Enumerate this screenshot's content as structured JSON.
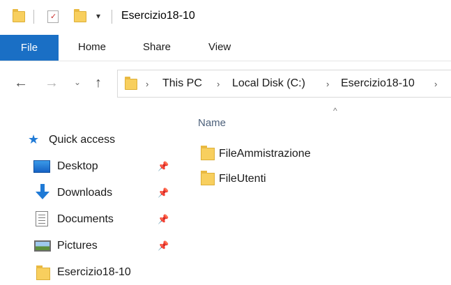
{
  "window": {
    "title": "Esercizio18-10"
  },
  "ribbon": {
    "tabs": [
      "File",
      "Home",
      "Share",
      "View"
    ]
  },
  "address": {
    "crumbs": [
      "This PC",
      "Local Disk (C:)",
      "Esercizio18-10"
    ]
  },
  "sidebar": {
    "quick_access": "Quick access",
    "items": [
      {
        "label": "Desktop",
        "icon": "desktop-icon",
        "pinned": true
      },
      {
        "label": "Downloads",
        "icon": "downloads-icon",
        "pinned": true
      },
      {
        "label": "Documents",
        "icon": "documents-icon",
        "pinned": true
      },
      {
        "label": "Pictures",
        "icon": "pictures-icon",
        "pinned": true
      },
      {
        "label": "Esercizio18-10",
        "icon": "folder-icon",
        "pinned": false
      }
    ]
  },
  "content": {
    "column_header": "Name",
    "files": [
      "FileAmmistrazione",
      "FileUtenti"
    ]
  },
  "colors": {
    "file_tab": "#1a6fc5",
    "folder": "#f8cf5e",
    "accent_blue": "#1f7ad6",
    "column_header": "#4c607a"
  }
}
